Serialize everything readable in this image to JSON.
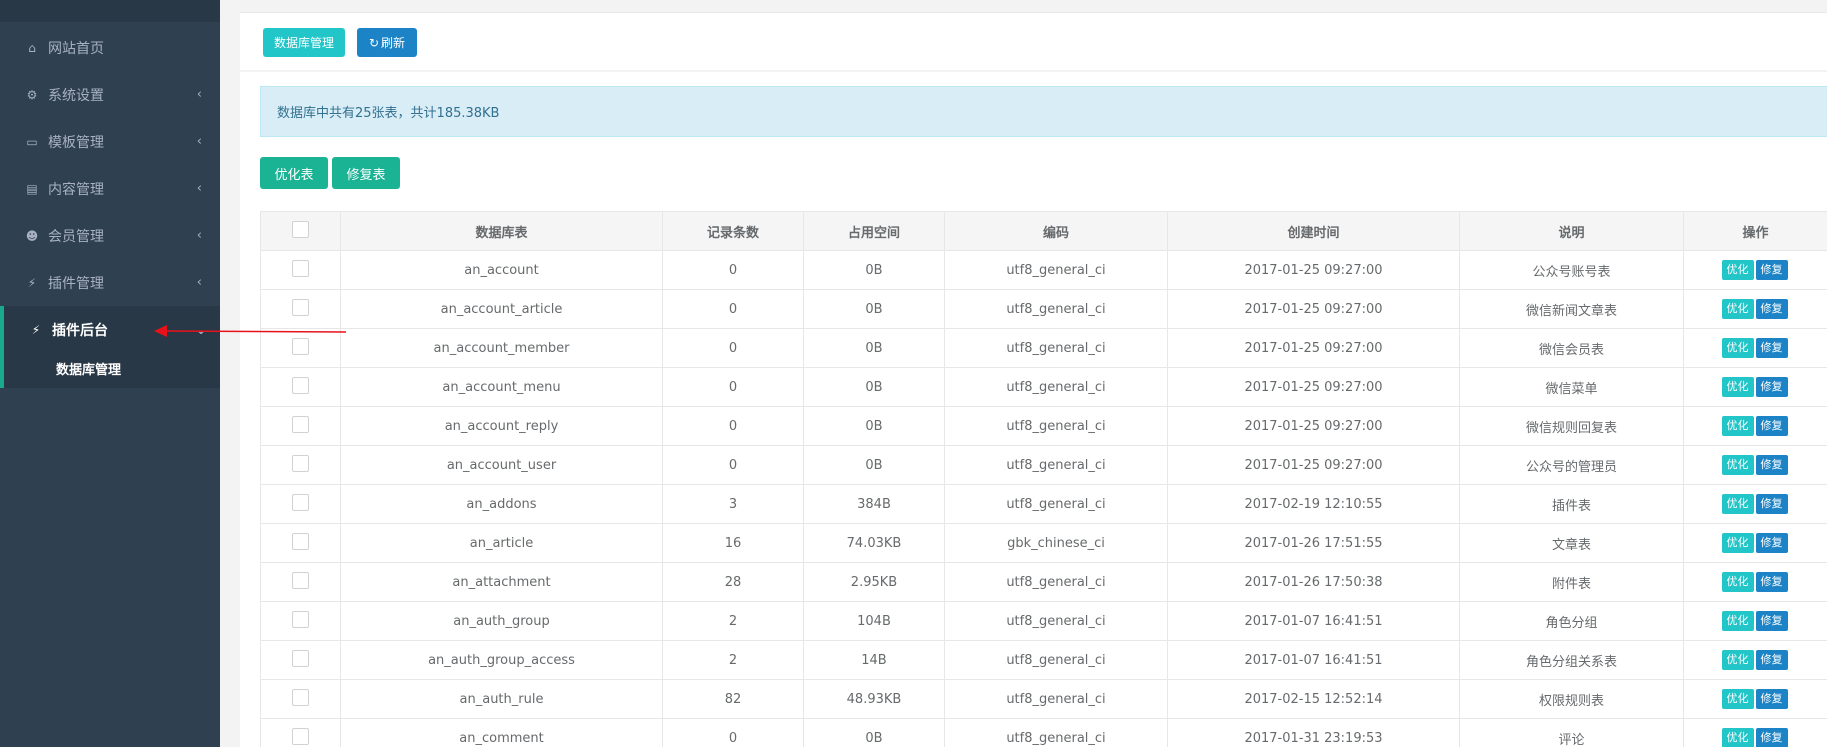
{
  "sidebar": {
    "items": [
      {
        "label": "网站首页",
        "icon": "home-icon",
        "glyph": "⌂",
        "has_children": false
      },
      {
        "label": "系统设置",
        "icon": "gears-icon",
        "glyph": "⚙",
        "has_children": true
      },
      {
        "label": "模板管理",
        "icon": "desktop-icon",
        "glyph": "▭",
        "has_children": true
      },
      {
        "label": "内容管理",
        "icon": "book-icon",
        "glyph": "▤",
        "has_children": true
      },
      {
        "label": "会员管理",
        "icon": "users-icon",
        "glyph": "☻",
        "has_children": true
      },
      {
        "label": "插件管理",
        "icon": "plug-icon",
        "glyph": "⚡",
        "has_children": true
      }
    ],
    "active": {
      "label": "插件后台",
      "icon": "plug-icon",
      "glyph": "⚡",
      "sub_items": [
        {
          "label": "数据库管理"
        }
      ]
    }
  },
  "toolbar": {
    "db_manage_label": "数据库管理",
    "refresh_label": "刷新",
    "refresh_glyph": "↻"
  },
  "alert": {
    "text": "数据库中共有25张表，共计185.38KB"
  },
  "actions": {
    "optimize_label": "优化表",
    "repair_label": "修复表"
  },
  "table": {
    "columns": [
      "数据库表",
      "记录条数",
      "占用空间",
      "编码",
      "创建时间",
      "说明",
      "操作"
    ],
    "row_optimize_label": "优化",
    "row_repair_label": "修复",
    "rows": [
      {
        "name": "an_account",
        "records": "0",
        "size": "0B",
        "encoding": "utf8_general_ci",
        "created": "2017-01-25 09:27:00",
        "desc": "公众号账号表"
      },
      {
        "name": "an_account_article",
        "records": "0",
        "size": "0B",
        "encoding": "utf8_general_ci",
        "created": "2017-01-25 09:27:00",
        "desc": "微信新闻文章表"
      },
      {
        "name": "an_account_member",
        "records": "0",
        "size": "0B",
        "encoding": "utf8_general_ci",
        "created": "2017-01-25 09:27:00",
        "desc": "微信会员表"
      },
      {
        "name": "an_account_menu",
        "records": "0",
        "size": "0B",
        "encoding": "utf8_general_ci",
        "created": "2017-01-25 09:27:00",
        "desc": "微信菜单"
      },
      {
        "name": "an_account_reply",
        "records": "0",
        "size": "0B",
        "encoding": "utf8_general_ci",
        "created": "2017-01-25 09:27:00",
        "desc": "微信规则回复表"
      },
      {
        "name": "an_account_user",
        "records": "0",
        "size": "0B",
        "encoding": "utf8_general_ci",
        "created": "2017-01-25 09:27:00",
        "desc": "公众号的管理员"
      },
      {
        "name": "an_addons",
        "records": "3",
        "size": "384B",
        "encoding": "utf8_general_ci",
        "created": "2017-02-19 12:10:55",
        "desc": "插件表"
      },
      {
        "name": "an_article",
        "records": "16",
        "size": "74.03KB",
        "encoding": "gbk_chinese_ci",
        "created": "2017-01-26 17:51:55",
        "desc": "文章表"
      },
      {
        "name": "an_attachment",
        "records": "28",
        "size": "2.95KB",
        "encoding": "utf8_general_ci",
        "created": "2017-01-26 17:50:38",
        "desc": "附件表"
      },
      {
        "name": "an_auth_group",
        "records": "2",
        "size": "104B",
        "encoding": "utf8_general_ci",
        "created": "2017-01-07 16:41:51",
        "desc": "角色分组"
      },
      {
        "name": "an_auth_group_access",
        "records": "2",
        "size": "14B",
        "encoding": "utf8_general_ci",
        "created": "2017-01-07 16:41:51",
        "desc": "角色分组关系表"
      },
      {
        "name": "an_auth_rule",
        "records": "82",
        "size": "48.93KB",
        "encoding": "utf8_general_ci",
        "created": "2017-02-15 12:52:14",
        "desc": "权限规则表"
      },
      {
        "name": "an_comment",
        "records": "0",
        "size": "0B",
        "encoding": "utf8_general_ci",
        "created": "2017-01-31 23:19:53",
        "desc": "评论"
      }
    ]
  },
  "annotation_color": "#e8121b"
}
